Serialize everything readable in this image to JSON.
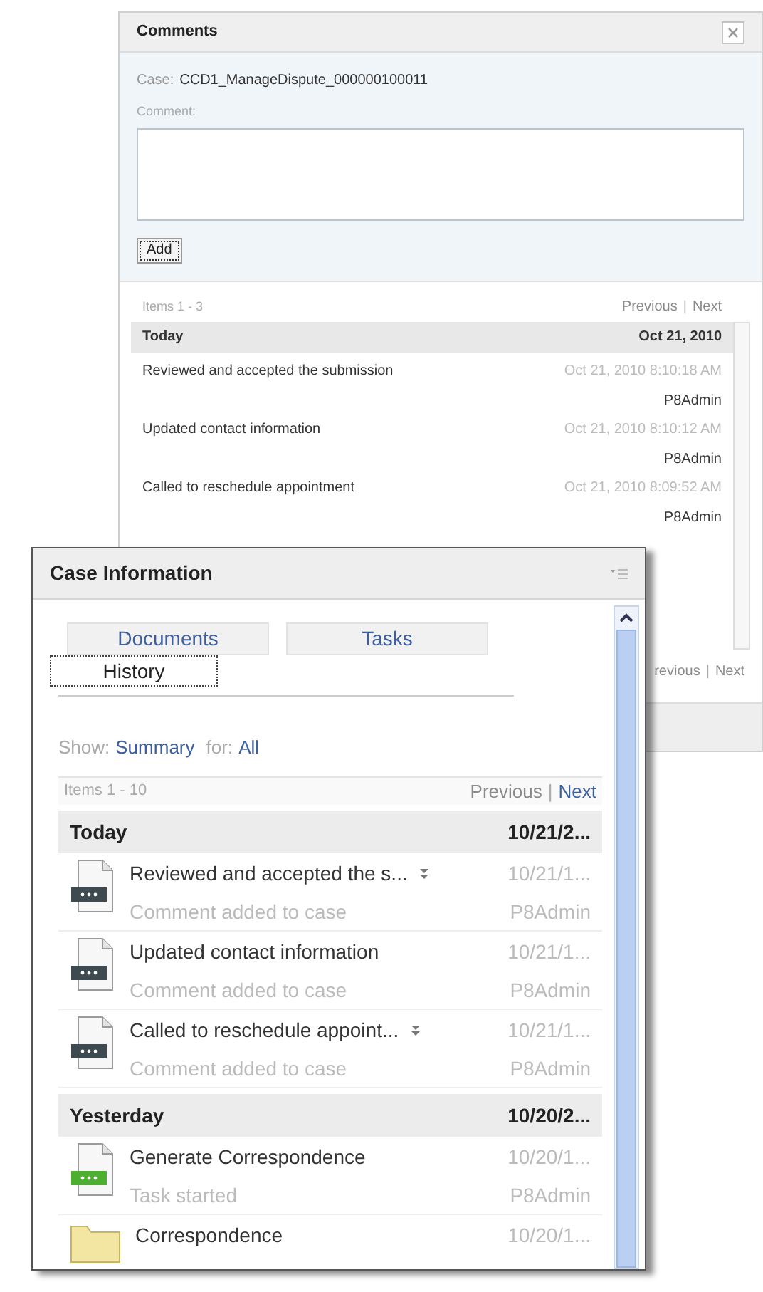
{
  "comments": {
    "title": "Comments",
    "case_label": "Case:",
    "case_value": "CCD1_ManageDispute_000000100011",
    "comment_label": "Comment:",
    "add_button": "Add",
    "pager": {
      "range": "Items 1 - 3",
      "previous": "Previous",
      "separator": "|",
      "next": "Next"
    },
    "groups": [
      {
        "label": "Today",
        "date": "Oct 21, 2010",
        "rows": [
          {
            "text": "Reviewed and accepted the submission",
            "time": "Oct 21, 2010 8:10:18 AM",
            "user": "P8Admin"
          },
          {
            "text": "Updated contact information",
            "time": "Oct 21, 2010 8:10:12 AM",
            "user": "P8Admin"
          },
          {
            "text": "Called to reschedule appointment",
            "time": "Oct 21, 2010 8:09:52 AM",
            "user": "P8Admin"
          }
        ]
      }
    ],
    "bottom_pager": {
      "previous": "revious",
      "separator": "|",
      "next": "Next"
    }
  },
  "case_info": {
    "title": "Case Information",
    "tabs": [
      {
        "label": "Documents",
        "selected": false
      },
      {
        "label": "Tasks",
        "selected": false
      },
      {
        "label": "History",
        "selected": true
      }
    ],
    "show_label": "Show:",
    "show_value": "Summary",
    "for_label": "for:",
    "for_value": "All",
    "pager": {
      "range": "Items 1 - 10",
      "previous": "Previous",
      "separator": "|",
      "next": "Next"
    },
    "groups": [
      {
        "label": "Today",
        "date": "10/21/2...",
        "rows": [
          {
            "kind": "comment",
            "title": "Reviewed and accepted the s...",
            "expandable": true,
            "date": "10/21/1...",
            "subtitle": "Comment added to case",
            "user": "P8Admin"
          },
          {
            "kind": "comment",
            "title": "Updated contact information",
            "expandable": false,
            "date": "10/21/1...",
            "subtitle": "Comment added to case",
            "user": "P8Admin"
          },
          {
            "kind": "comment",
            "title": "Called to reschedule appoint...",
            "expandable": true,
            "date": "10/21/1...",
            "subtitle": "Comment added to case",
            "user": "P8Admin"
          }
        ]
      },
      {
        "label": "Yesterday",
        "date": "10/20/2...",
        "rows": [
          {
            "kind": "task",
            "title": "Generate Correspondence",
            "expandable": false,
            "date": "10/20/1...",
            "subtitle": "Task started",
            "user": "P8Admin"
          },
          {
            "kind": "folder",
            "title": "Correspondence",
            "expandable": false,
            "date": "10/20/1..."
          }
        ]
      }
    ]
  }
}
